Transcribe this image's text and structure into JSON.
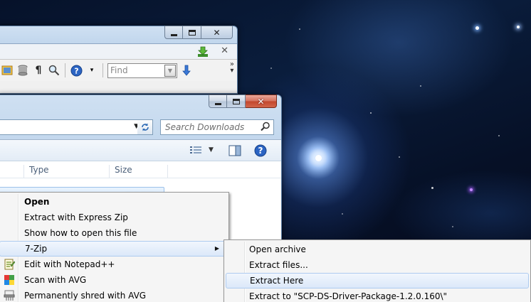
{
  "back_window": {
    "find_placeholder": "Find",
    "toolbar_icons": [
      "picture-icon",
      "database-icon",
      "pilcrow-icon",
      "zoom-icon",
      "help-icon"
    ]
  },
  "explorer": {
    "search_placeholder": "Search Downloads",
    "columns": [
      "Type",
      "Size"
    ]
  },
  "context_menu": {
    "items": [
      {
        "label": "Open",
        "bold": true
      },
      {
        "label": "Extract with Express Zip"
      },
      {
        "label": "Show how to open this file"
      },
      {
        "label": "7-Zip",
        "submenu": true,
        "highlighted": true
      },
      {
        "label": "Edit with Notepad++",
        "icon": "notepadpp-icon"
      },
      {
        "label": "Scan with AVG",
        "icon": "avg-icon"
      },
      {
        "label": "Permanently shred with AVG",
        "icon": "shredder-icon"
      }
    ]
  },
  "submenu_7zip": {
    "items": [
      {
        "label": "Open archive"
      },
      {
        "label": "Extract files..."
      },
      {
        "label": "Extract Here",
        "highlighted": true
      },
      {
        "label": "Extract to \"SCP-DS-Driver-Package-1.2.0.160\\\""
      }
    ]
  },
  "colors": {
    "menu_highlight": "#dbe8f9",
    "menu_highlight_border": "#aecbf0",
    "close_button": "#c2462c",
    "window_frame": "#b9d1ea"
  }
}
